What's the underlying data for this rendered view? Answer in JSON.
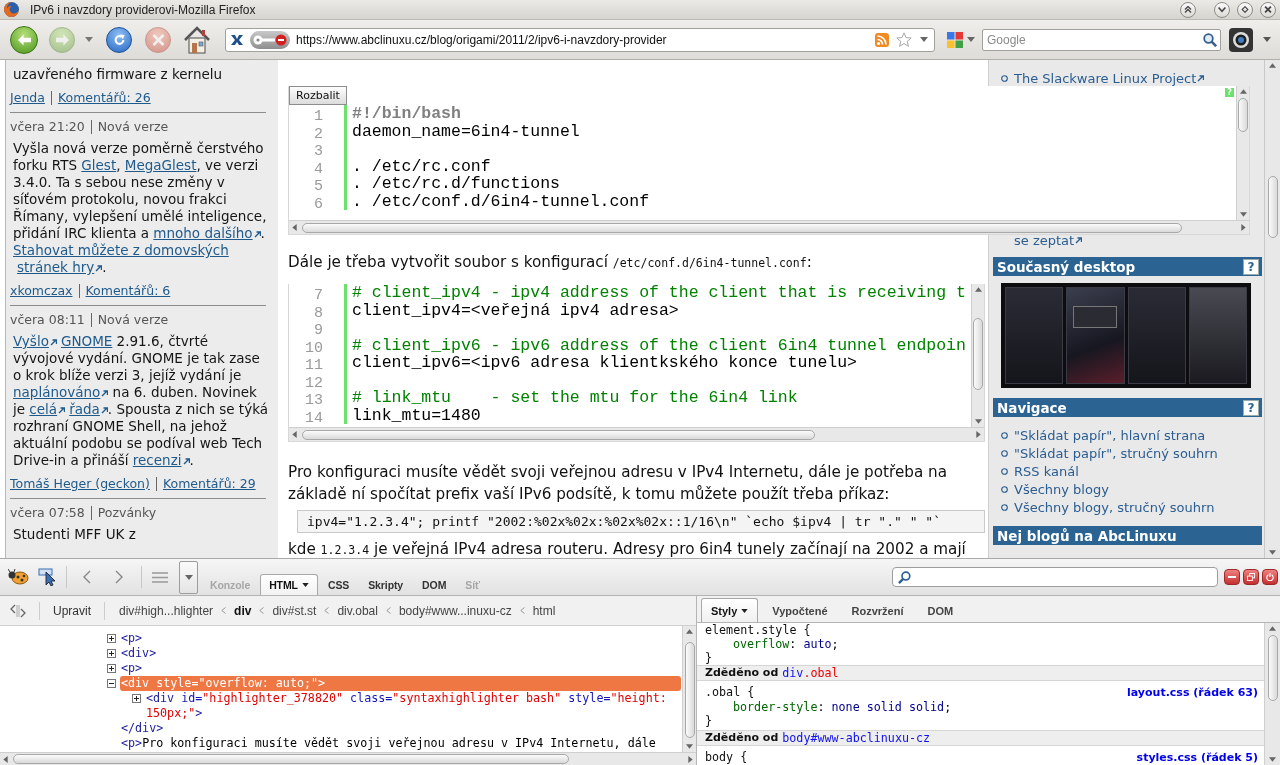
{
  "window": {
    "title": "IPv6 i navzdory providerovi-Mozilla Firefox"
  },
  "toolbar": {
    "nav_buttons": [
      {
        "kind": "back",
        "disabled": false
      },
      {
        "kind": "forward",
        "disabled": true
      },
      {
        "kind": "reload",
        "disabled": false
      },
      {
        "kind": "stop",
        "disabled": true
      },
      {
        "kind": "home",
        "disabled": false
      }
    ],
    "url": "https://www.abclinuxu.cz/blog/origami/2011/2/ipv6-i-navzdory-provider",
    "search": {
      "placeholder": "Google"
    }
  },
  "left_column": {
    "items": [
      {
        "body": [
          {
            "kind": "text",
            "text": "uzavřeného firmware z kernelu"
          }
        ],
        "author": "Jenda",
        "comments": "Komentářů: 26"
      },
      {
        "time": "včera 21:20",
        "category": "Nová verze",
        "body": [
          {
            "kind": "text",
            "text": "Vyšla nová verze poměrně čerstvého forku RTS "
          },
          {
            "kind": "link",
            "text": "Glest"
          },
          {
            "kind": "text",
            "text": ", "
          },
          {
            "kind": "link",
            "text": "MegaGlest"
          },
          {
            "kind": "text",
            "text": ", ve verzi 3.4.0. Ta s sebou nese změny v síťovém protokolu, novou frakci Římany, vylepšení umělé inteligence, přidání IRC klienta a "
          },
          {
            "kind": "extlink",
            "text": "mnoho dalšího"
          },
          {
            "kind": "text",
            "text": ". "
          },
          {
            "kind": "link",
            "text": "Stahovat můžete z domovských"
          },
          {
            "kind": "extlink",
            "text": "stránek hry"
          },
          {
            "kind": "text",
            "text": "."
          }
        ],
        "author": "xkomczax",
        "comments": "Komentářů: 6"
      },
      {
        "time": "včera 08:11",
        "category": "Nová verze",
        "body": [
          {
            "kind": "extlink",
            "text": "Vyšlo"
          },
          {
            "kind": "link",
            "text": "GNOME"
          },
          {
            "kind": "text",
            "text": " 2.91.6, čtvrté vývojové vydání. GNOME je tak zase o krok blíže verzi 3, jejíž vydání je "
          },
          {
            "kind": "extlink",
            "text": "naplánováno"
          },
          {
            "kind": "text",
            "text": " na 6. duben. Novinek je "
          },
          {
            "kind": "extlink",
            "text": "celá"
          },
          {
            "kind": "extlink",
            "text": "řada"
          },
          {
            "kind": "text",
            "text": ". Spousta z nich se týká rozhraní GNOME Shell, na jehož aktuální podobu se podíval web Tech Drive-in a přináší "
          },
          {
            "kind": "extlink",
            "text": "recenzi"
          },
          {
            "kind": "text",
            "text": "."
          }
        ],
        "author": "Tomáš Heger (geckon)",
        "comments": "Komentářů: 29"
      },
      {
        "time": "včera 07:58",
        "category": "Pozvánky",
        "body": [
          {
            "kind": "text",
            "text": "Studenti MFF UK z"
          }
        ]
      }
    ]
  },
  "main": {
    "blocks": [
      {
        "kind": "code",
        "button": "Rozbalit",
        "help": "?",
        "lines": [
          {
            "number": "1",
            "kind": "shebang",
            "code": "#!/bin/bash"
          },
          {
            "number": "2",
            "kind": "plain",
            "code": "daemon_name=6in4-tunnel"
          },
          {
            "number": "3"
          },
          {
            "number": "4",
            "kind": "plain",
            "code": ". /etc/rc.conf"
          },
          {
            "number": "5",
            "kind": "plain",
            "code": ". /etc/rc.d/functions"
          },
          {
            "number": "6",
            "kind": "plain",
            "code": ". /etc/conf.d/6in4-tunnel.conf"
          }
        ]
      },
      {
        "kind": "para",
        "segments": [
          {
            "kind": "text",
            "text": "Dále je třeba vytvořit soubor s konfigurací "
          },
          {
            "kind": "code",
            "text": "/etc/conf.d/6in4-tunnel.conf"
          },
          {
            "kind": "text",
            "text": ":"
          }
        ]
      },
      {
        "kind": "code",
        "lines": [
          {
            "number": "7",
            "kind": "comment",
            "code": "# client_ipv4 - ipv4 address of the client that is receiving t"
          },
          {
            "number": "8",
            "kind": "plain",
            "code": "client_ipv4=<veřejná ipv4 adresa>"
          },
          {
            "number": "9"
          },
          {
            "number": "10",
            "kind": "comment",
            "code": "# client_ipv6 - ipv6 address of the client 6in4 tunnel endpoin"
          },
          {
            "number": "11",
            "kind": "plain",
            "code": "client_ipv6=<ipv6 adresa klientkského konce tunelu>"
          },
          {
            "number": "12"
          },
          {
            "number": "13",
            "kind": "comment",
            "code": "# link_mtu    - set the mtu for the 6in4 link"
          },
          {
            "number": "14",
            "kind": "plain",
            "code": "link_mtu=1480"
          }
        ]
      },
      {
        "kind": "para",
        "segments": [
          {
            "kind": "text",
            "text": "Pro konfiguraci musíte vědět svoji veřejnou adresu v IPv4 Internetu, dále je potřeba na základě ní spočítat prefix vaší IPv6 podsítě, k tomu můžete použít třeba příkaz:"
          }
        ]
      },
      {
        "kind": "command",
        "text": "ipv4=\"1.2.3.4\"; printf \"2002:%02x%02x:%02x%02x::1/16\\n\" `echo $ipv4 | tr \".\" \" \"`"
      },
      {
        "kind": "para",
        "segments": [
          {
            "kind": "text",
            "text": "kde "
          },
          {
            "kind": "code",
            "text": "1.2.3.4"
          },
          {
            "kind": "text",
            "text": " je veřejná IPv4 adresa routeru. Adresy pro 6in4 tunely začínají na 2002 a mají"
          }
        ]
      }
    ]
  },
  "right_column": {
    "links": [
      {
        "text": "The Slackware Linux Project"
      }
    ],
    "continued_link": "se zeptat",
    "sections": [
      {
        "kind": "image",
        "title": "Současný desktop",
        "help": "?"
      },
      {
        "kind": "list",
        "title": "Navigace",
        "help": "?",
        "items": [
          "\"Skládat papír\", hlavní strana",
          "\"Skládat papír\", stručný souhrn",
          "RSS kanál",
          "Všechny blogy",
          "Všechny blogy, stručný souhrn"
        ]
      },
      {
        "kind": "list",
        "title": "Nej blogů na AbcLinuxu"
      }
    ]
  },
  "devtools": {
    "tabs": [
      {
        "label": "Konzole",
        "selected": false,
        "disabled": true
      },
      {
        "label": "HTML",
        "selected": true,
        "disabled": false
      },
      {
        "label": "CSS",
        "selected": false,
        "disabled": false
      },
      {
        "label": "Skripty",
        "selected": false,
        "disabled": false
      },
      {
        "label": "DOM",
        "selected": false,
        "disabled": false
      },
      {
        "label": "Síť",
        "selected": false,
        "disabled": true
      }
    ],
    "edit_button": "Upravit",
    "breadcrumbs": [
      {
        "label": "div#high...hlighter",
        "selected": false
      },
      {
        "label": "div",
        "selected": true
      },
      {
        "label": "div#st.st",
        "selected": false
      },
      {
        "label": "div.obal",
        "selected": false
      },
      {
        "label": "body#www...inuxu-cz",
        "selected": false
      },
      {
        "label": "html",
        "selected": false
      }
    ],
    "tree": [
      {
        "kind": "element",
        "expanded": false,
        "selected": false,
        "tokens": [
          {
            "kind": "tag",
            "text": "<p>"
          }
        ]
      },
      {
        "kind": "element",
        "expanded": false,
        "selected": false,
        "tokens": [
          {
            "kind": "tag",
            "text": "<div>"
          }
        ]
      },
      {
        "kind": "element",
        "expanded": false,
        "selected": false,
        "tokens": [
          {
            "kind": "tag",
            "text": "<p>"
          }
        ]
      },
      {
        "kind": "element",
        "expanded": true,
        "selected": true,
        "tokens": [
          {
            "kind": "tag",
            "text": "<div"
          },
          {
            "kind": "attr",
            "text": " style="
          },
          {
            "kind": "value",
            "text": "\"overflow: auto;\""
          },
          {
            "kind": "tag",
            "text": ">"
          }
        ],
        "children": [
          {
            "kind": "element",
            "expanded": false,
            "selected": false,
            "tokens": [
              {
                "kind": "tag",
                "text": "<div"
              },
              {
                "kind": "attr",
                "text": " id="
              },
              {
                "kind": "value",
                "text": "\"highlighter_378820\""
              },
              {
                "kind": "attr",
                "text": " class="
              },
              {
                "kind": "value",
                "text": "\"syntaxhighlighter bash\""
              },
              {
                "kind": "attr",
                "text": " style="
              },
              {
                "kind": "value",
                "text": "\"height: 150px;\""
              },
              {
                "kind": "tag",
                "text": ">"
              }
            ]
          }
        ],
        "closing": [
          {
            "kind": "tag",
            "text": "</div>"
          }
        ]
      },
      {
        "kind": "leaf",
        "selected": false,
        "tokens": [
          {
            "kind": "tag",
            "text": "<p>"
          },
          {
            "kind": "text",
            "text": "Pro konfiguraci musíte vědět svoji veřejnou adresu v IPv4 Internetu, dále"
          }
        ]
      }
    ],
    "side_tabs": [
      {
        "label": "Styly",
        "selected": true
      },
      {
        "label": "Vypočtené",
        "selected": false
      },
      {
        "label": "Rozvržení",
        "selected": false
      },
      {
        "label": "DOM",
        "selected": false
      }
    ],
    "styles": [
      {
        "kind": "rule",
        "selector": "element.style {",
        "props": [
          {
            "tokens": [
              {
                "kind": "property",
                "text": "overflow"
              },
              {
                "kind": "punct",
                "text": ": "
              },
              {
                "kind": "keyword",
                "text": "auto"
              },
              {
                "kind": "punct",
                "text": ";"
              }
            ]
          }
        ],
        "close": "}"
      },
      {
        "kind": "inherited",
        "label": "Zděděno od",
        "tokens": [
          {
            "kind": "element",
            "text": "div"
          },
          {
            "kind": "class",
            "text": ".obal"
          }
        ]
      },
      {
        "kind": "rule",
        "selector": ".obal {",
        "source": "layout.css (řádek 63)",
        "props": [
          {
            "tokens": [
              {
                "kind": "property",
                "text": "border-style"
              },
              {
                "kind": "punct",
                "text": ": "
              },
              {
                "kind": "keyword",
                "text": "none solid solid"
              },
              {
                "kind": "punct",
                "text": ";"
              }
            ]
          }
        ],
        "close": "}"
      },
      {
        "kind": "inherited",
        "label": "Zděděno od",
        "tokens": [
          {
            "kind": "element",
            "text": "body#www-abclinuxu-cz"
          }
        ]
      },
      {
        "kind": "rule",
        "selector": "body {",
        "source": "styles.css (řádek 5)"
      }
    ]
  }
}
